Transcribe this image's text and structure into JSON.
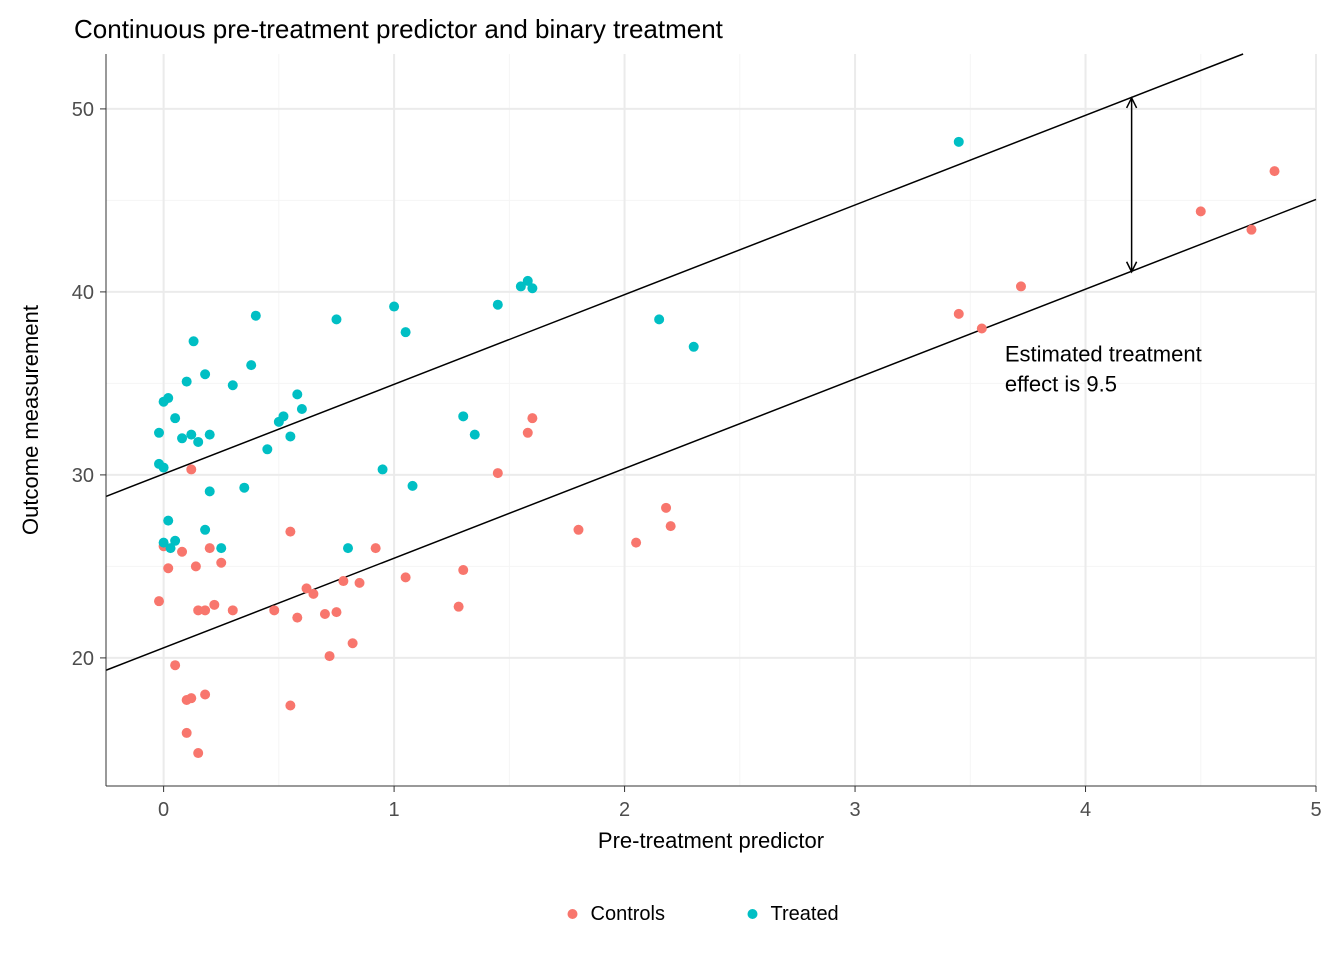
{
  "chart_data": {
    "type": "scatter",
    "title": "Continuous pre-treatment predictor and binary treatment",
    "xlabel": "Pre-treatment predictor",
    "ylabel": "Outcome measurement",
    "xlim": [
      -0.25,
      5.0
    ],
    "ylim": [
      13,
      53
    ],
    "x_ticks": [
      0,
      1,
      2,
      3,
      4,
      5
    ],
    "y_ticks": [
      20,
      30,
      40,
      50
    ],
    "legend": {
      "position": "bottom",
      "items": [
        "Controls",
        "Treated"
      ]
    },
    "colors": {
      "Controls": "#F8766D",
      "Treated": "#00BFC4"
    },
    "series": [
      {
        "name": "Controls",
        "points": [
          [
            -0.02,
            23.1
          ],
          [
            0.0,
            26.1
          ],
          [
            0.02,
            24.9
          ],
          [
            0.05,
            19.6
          ],
          [
            0.08,
            25.8
          ],
          [
            0.1,
            17.7
          ],
          [
            0.1,
            15.9
          ],
          [
            0.12,
            17.8
          ],
          [
            0.12,
            30.3
          ],
          [
            0.14,
            25.0
          ],
          [
            0.15,
            22.6
          ],
          [
            0.15,
            14.8
          ],
          [
            0.18,
            18.0
          ],
          [
            0.18,
            22.6
          ],
          [
            0.2,
            26.0
          ],
          [
            0.22,
            22.9
          ],
          [
            0.25,
            25.2
          ],
          [
            0.3,
            22.6
          ],
          [
            0.48,
            22.6
          ],
          [
            0.55,
            26.9
          ],
          [
            0.55,
            17.4
          ],
          [
            0.58,
            22.2
          ],
          [
            0.62,
            23.8
          ],
          [
            0.65,
            23.5
          ],
          [
            0.7,
            22.4
          ],
          [
            0.72,
            20.1
          ],
          [
            0.75,
            22.5
          ],
          [
            0.78,
            24.2
          ],
          [
            0.82,
            20.8
          ],
          [
            0.85,
            24.1
          ],
          [
            0.92,
            26.0
          ],
          [
            1.05,
            24.4
          ],
          [
            1.28,
            22.8
          ],
          [
            1.3,
            24.8
          ],
          [
            1.45,
            30.1
          ],
          [
            1.58,
            32.3
          ],
          [
            1.6,
            33.1
          ],
          [
            1.8,
            27.0
          ],
          [
            2.05,
            26.3
          ],
          [
            2.18,
            28.2
          ],
          [
            2.2,
            27.2
          ],
          [
            3.45,
            38.8
          ],
          [
            3.55,
            38.0
          ],
          [
            3.72,
            40.3
          ],
          [
            4.5,
            44.4
          ],
          [
            4.72,
            43.4
          ],
          [
            4.82,
            46.6
          ]
        ]
      },
      {
        "name": "Treated",
        "points": [
          [
            -0.02,
            32.3
          ],
          [
            -0.02,
            30.6
          ],
          [
            0.0,
            34.0
          ],
          [
            0.0,
            26.3
          ],
          [
            0.0,
            30.4
          ],
          [
            0.02,
            34.2
          ],
          [
            0.02,
            27.5
          ],
          [
            0.03,
            26.0
          ],
          [
            0.05,
            33.1
          ],
          [
            0.05,
            26.4
          ],
          [
            0.08,
            32.0
          ],
          [
            0.1,
            35.1
          ],
          [
            0.12,
            32.2
          ],
          [
            0.13,
            37.3
          ],
          [
            0.15,
            31.8
          ],
          [
            0.18,
            35.5
          ],
          [
            0.18,
            27.0
          ],
          [
            0.2,
            32.2
          ],
          [
            0.2,
            29.1
          ],
          [
            0.25,
            26.0
          ],
          [
            0.3,
            34.9
          ],
          [
            0.35,
            29.3
          ],
          [
            0.38,
            36.0
          ],
          [
            0.4,
            38.7
          ],
          [
            0.45,
            31.4
          ],
          [
            0.5,
            32.9
          ],
          [
            0.52,
            33.2
          ],
          [
            0.55,
            32.1
          ],
          [
            0.58,
            34.4
          ],
          [
            0.6,
            33.6
          ],
          [
            0.75,
            38.5
          ],
          [
            0.8,
            26.0
          ],
          [
            0.95,
            30.3
          ],
          [
            1.0,
            39.2
          ],
          [
            1.05,
            37.8
          ],
          [
            1.08,
            29.4
          ],
          [
            1.3,
            33.2
          ],
          [
            1.35,
            32.2
          ],
          [
            1.45,
            39.3
          ],
          [
            1.55,
            40.3
          ],
          [
            1.58,
            40.6
          ],
          [
            1.6,
            40.2
          ],
          [
            2.15,
            38.5
          ],
          [
            2.3,
            37.0
          ],
          [
            3.45,
            48.2
          ]
        ]
      }
    ],
    "regression_lines": [
      {
        "name": "Controls",
        "intercept": 20.55,
        "slope": 4.9
      },
      {
        "name": "Treated",
        "intercept": 30.05,
        "slope": 4.9
      }
    ],
    "annotation": {
      "text_lines": [
        "Estimated treatment",
        "effect is  9.5"
      ],
      "arrow": {
        "x": 4.2,
        "y_from": 41.1,
        "y_to": 50.6
      }
    }
  }
}
